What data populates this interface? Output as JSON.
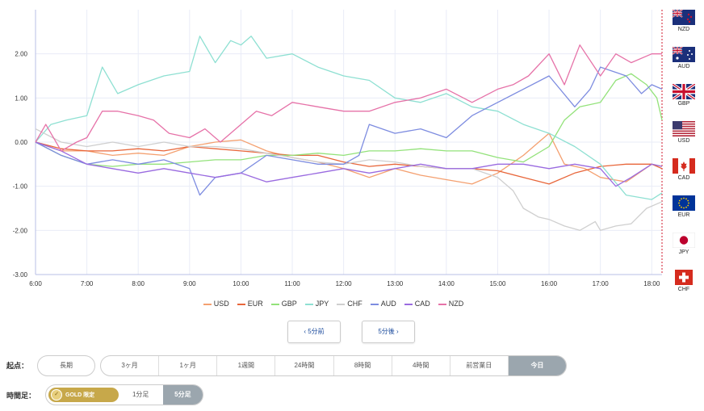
{
  "chart_data": {
    "type": "line",
    "y_ticks": [
      "2.00",
      "1.00",
      "0.00",
      "-1.00",
      "-2.00",
      "-3.00"
    ],
    "y_tick_values": [
      2,
      1,
      0,
      -1,
      -2,
      -3
    ],
    "ylim": [
      -3.0,
      3.0
    ],
    "x_ticks": [
      "6:00",
      "7:00",
      "8:00",
      "9:00",
      "10:00",
      "11:00",
      "12:00",
      "13:00",
      "14:00",
      "15:00",
      "16:00",
      "17:00",
      "18:00"
    ],
    "x_tick_values": [
      6,
      7,
      8,
      9,
      10,
      11,
      12,
      13,
      14,
      15,
      16,
      17,
      18
    ],
    "xlim": [
      6.0,
      18.2
    ],
    "grid": true,
    "legend_position": "bottom",
    "series": [
      {
        "name": "USD",
        "color": "#f4a070",
        "x": [
          6.0,
          6.5,
          7.0,
          7.5,
          8.0,
          8.5,
          9.0,
          9.5,
          10.0,
          10.5,
          11.0,
          11.5,
          12.0,
          12.5,
          13.0,
          13.5,
          14.0,
          14.5,
          15.0,
          15.5,
          15.8,
          16.0,
          16.3,
          16.7,
          17.0,
          17.5,
          18.0,
          18.2
        ],
        "y": [
          0.0,
          -0.2,
          -0.2,
          -0.3,
          -0.25,
          -0.3,
          -0.1,
          0.0,
          0.05,
          -0.2,
          -0.35,
          -0.45,
          -0.6,
          -0.8,
          -0.6,
          -0.75,
          -0.85,
          -0.95,
          -0.7,
          -0.3,
          0.0,
          0.2,
          -0.5,
          -0.6,
          -0.8,
          -0.9,
          -0.5,
          -0.55
        ]
      },
      {
        "name": "EUR",
        "color": "#e8663a",
        "x": [
          6.0,
          6.5,
          7.0,
          7.5,
          8.0,
          8.5,
          9.0,
          9.5,
          10.0,
          10.5,
          11.0,
          11.5,
          12.0,
          12.5,
          13.0,
          13.5,
          14.0,
          14.5,
          15.0,
          15.5,
          16.0,
          16.5,
          17.0,
          17.5,
          18.0,
          18.2
        ],
        "y": [
          0.0,
          -0.15,
          -0.2,
          -0.2,
          -0.15,
          -0.2,
          -0.1,
          -0.15,
          -0.2,
          -0.25,
          -0.3,
          -0.3,
          -0.45,
          -0.55,
          -0.5,
          -0.55,
          -0.6,
          -0.6,
          -0.65,
          -0.8,
          -0.95,
          -0.7,
          -0.55,
          -0.5,
          -0.5,
          -0.6
        ]
      },
      {
        "name": "GBP",
        "color": "#93e27a",
        "x": [
          6.0,
          6.5,
          7.0,
          7.5,
          8.0,
          8.5,
          9.0,
          9.5,
          10.0,
          10.5,
          11.0,
          11.5,
          12.0,
          12.5,
          13.0,
          13.5,
          14.0,
          14.5,
          15.0,
          15.5,
          16.0,
          16.3,
          16.6,
          17.0,
          17.3,
          17.6,
          17.9,
          18.1,
          18.2
        ],
        "y": [
          0.0,
          -0.3,
          -0.5,
          -0.55,
          -0.5,
          -0.5,
          -0.45,
          -0.4,
          -0.4,
          -0.3,
          -0.3,
          -0.25,
          -0.3,
          -0.2,
          -0.2,
          -0.15,
          -0.2,
          -0.2,
          -0.35,
          -0.45,
          -0.1,
          0.5,
          0.8,
          0.9,
          1.4,
          1.55,
          1.3,
          1.0,
          0.5
        ]
      },
      {
        "name": "JPY",
        "color": "#8ee0d2",
        "x": [
          6.0,
          6.3,
          6.6,
          7.0,
          7.3,
          7.6,
          8.0,
          8.5,
          9.0,
          9.2,
          9.5,
          9.8,
          10.0,
          10.2,
          10.5,
          11.0,
          11.5,
          12.0,
          12.5,
          13.0,
          13.5,
          14.0,
          14.5,
          15.0,
          15.5,
          16.0,
          16.5,
          17.0,
          17.5,
          18.0,
          18.2
        ],
        "y": [
          0.0,
          0.4,
          0.5,
          0.6,
          1.7,
          1.1,
          1.3,
          1.5,
          1.6,
          2.4,
          1.8,
          2.3,
          2.2,
          2.4,
          1.9,
          2.0,
          1.7,
          1.5,
          1.4,
          1.0,
          0.9,
          1.1,
          0.8,
          0.7,
          0.4,
          0.2,
          -0.1,
          -0.5,
          -1.2,
          -1.3,
          -1.15
        ]
      },
      {
        "name": "CHF",
        "color": "#cfcfcf",
        "x": [
          6.0,
          6.5,
          7.0,
          7.5,
          8.0,
          8.5,
          9.0,
          9.5,
          10.0,
          10.5,
          11.0,
          11.5,
          12.0,
          12.5,
          13.0,
          13.5,
          14.0,
          14.5,
          15.0,
          15.3,
          15.5,
          15.8,
          16.0,
          16.3,
          16.6,
          16.9,
          17.0,
          17.3,
          17.6,
          17.9,
          18.2
        ],
        "y": [
          0.3,
          0.0,
          -0.1,
          0.0,
          -0.1,
          0.0,
          -0.1,
          -0.1,
          -0.15,
          -0.25,
          -0.35,
          -0.45,
          -0.5,
          -0.4,
          -0.45,
          -0.55,
          -0.6,
          -0.6,
          -0.8,
          -1.1,
          -1.5,
          -1.7,
          -1.75,
          -1.9,
          -2.0,
          -1.8,
          -2.0,
          -1.9,
          -1.85,
          -1.5,
          -1.35
        ]
      },
      {
        "name": "AUD",
        "color": "#7d8ce0",
        "x": [
          6.0,
          6.5,
          7.0,
          7.5,
          8.0,
          8.5,
          9.0,
          9.2,
          9.5,
          10.0,
          10.5,
          11.0,
          11.5,
          12.0,
          12.3,
          12.5,
          13.0,
          13.5,
          14.0,
          14.5,
          15.0,
          15.5,
          16.0,
          16.5,
          16.8,
          17.0,
          17.5,
          17.8,
          18.0,
          18.2
        ],
        "y": [
          0.0,
          -0.3,
          -0.5,
          -0.4,
          -0.5,
          -0.4,
          -0.6,
          -1.2,
          -0.8,
          -0.7,
          -0.3,
          -0.4,
          -0.5,
          -0.5,
          -0.3,
          0.4,
          0.2,
          0.3,
          0.1,
          0.6,
          0.9,
          1.2,
          1.5,
          0.8,
          1.2,
          1.7,
          1.5,
          1.1,
          1.3,
          1.2
        ]
      },
      {
        "name": "CAD",
        "color": "#9a6be0",
        "x": [
          6.0,
          6.5,
          7.0,
          7.5,
          8.0,
          8.5,
          9.0,
          9.5,
          10.0,
          10.5,
          11.0,
          11.5,
          12.0,
          12.5,
          13.0,
          13.5,
          14.0,
          14.5,
          15.0,
          15.5,
          16.0,
          16.5,
          17.0,
          17.3,
          17.6,
          18.0,
          18.2
        ],
        "y": [
          0.0,
          -0.2,
          -0.5,
          -0.6,
          -0.7,
          -0.6,
          -0.7,
          -0.8,
          -0.7,
          -0.9,
          -0.8,
          -0.7,
          -0.6,
          -0.7,
          -0.6,
          -0.5,
          -0.6,
          -0.6,
          -0.5,
          -0.5,
          -0.6,
          -0.5,
          -0.6,
          -1.0,
          -0.8,
          -0.5,
          -0.55
        ]
      },
      {
        "name": "NZD",
        "color": "#e672a8",
        "x": [
          6.0,
          6.2,
          6.5,
          6.8,
          7.0,
          7.3,
          7.6,
          8.0,
          8.3,
          8.6,
          9.0,
          9.3,
          9.6,
          10.0,
          10.3,
          10.6,
          11.0,
          11.5,
          12.0,
          12.5,
          13.0,
          13.5,
          14.0,
          14.5,
          15.0,
          15.3,
          15.6,
          16.0,
          16.3,
          16.6,
          17.0,
          17.3,
          17.6,
          18.0,
          18.2
        ],
        "y": [
          0.0,
          0.4,
          -0.2,
          0.0,
          0.1,
          0.7,
          0.7,
          0.6,
          0.5,
          0.2,
          0.1,
          0.3,
          0.0,
          0.4,
          0.7,
          0.6,
          0.9,
          0.8,
          0.7,
          0.7,
          0.9,
          1.0,
          1.2,
          0.9,
          1.2,
          1.3,
          1.5,
          2.0,
          1.3,
          2.2,
          1.5,
          2.0,
          1.8,
          2.0,
          2.0
        ]
      }
    ]
  },
  "flags": [
    {
      "code": "NZD",
      "icon": "nz-flag-icon"
    },
    {
      "code": "AUD",
      "icon": "au-flag-icon"
    },
    {
      "code": "GBP",
      "icon": "gb-flag-icon"
    },
    {
      "code": "USD",
      "icon": "us-flag-icon"
    },
    {
      "code": "CAD",
      "icon": "ca-flag-icon"
    },
    {
      "code": "EUR",
      "icon": "eu-flag-icon"
    },
    {
      "code": "JPY",
      "icon": "jp-flag-icon"
    },
    {
      "code": "CHF",
      "icon": "ch-flag-icon"
    }
  ],
  "nav": {
    "prev": "‹ 5分前",
    "next": "5分後 ›"
  },
  "kiten": {
    "label": "起点：",
    "long": "長期",
    "options": [
      "3ヶ月",
      "1ヶ月",
      "1週間",
      "24時間",
      "8時間",
      "4時間",
      "前営業日",
      "今日"
    ],
    "active": "今日"
  },
  "ashi": {
    "label": "時間足：",
    "gold": "GOLD 限定",
    "options": [
      "1分足",
      "5分足"
    ],
    "active": "5分足"
  },
  "colors": {
    "axis": "#b8bfe6",
    "grid": "#e9ecf7",
    "active_bg": "#9ba6ae",
    "gold": "#c7a84a",
    "link": "#1a4a9c",
    "flag_border": "#d0192d"
  }
}
